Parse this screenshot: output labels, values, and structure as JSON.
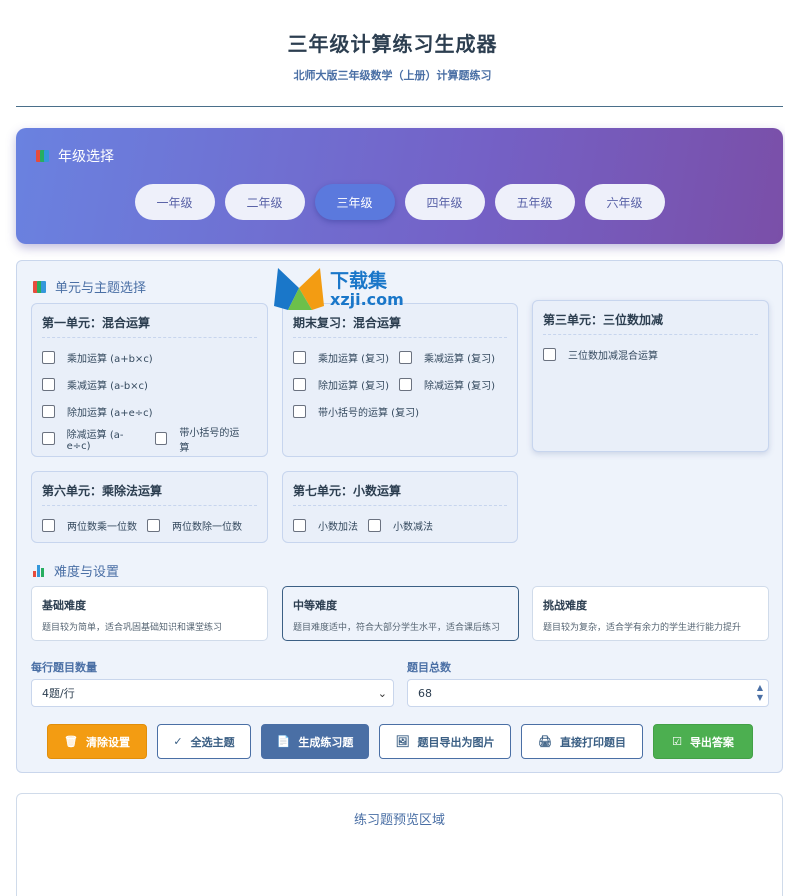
{
  "header": {
    "title": "三年级计算练习生成器",
    "subtitle": "北师大版三年级数学（上册）计算题练习"
  },
  "grade_section": {
    "label": "年级选择",
    "grades": [
      "一年级",
      "二年级",
      "三年级",
      "四年级",
      "五年级",
      "六年级"
    ],
    "active": "三年级"
  },
  "units_section": {
    "label": "单元与主题选择",
    "units": [
      {
        "title": "第一单元：混合运算",
        "options": [
          "乘加运算 (a+b×c)",
          "乘减运算 (a-b×c)",
          "除加运算 (a+e÷c)",
          "除减运算 (a-e÷c)",
          "带小括号的运算"
        ]
      },
      {
        "title": "期末复习：混合运算",
        "options": [
          "乘加运算 (复习)",
          "乘减运算 (复习)",
          "除加运算 (复习)",
          "除减运算 (复习)",
          "带小括号的运算 (复习)"
        ]
      },
      {
        "title": "第三单元：三位数加减",
        "options": [
          "三位数加减混合运算"
        ]
      },
      {
        "title": "第六单元：乘除法运算",
        "options": [
          "两位数乘一位数",
          "两位数除一位数"
        ]
      },
      {
        "title": "第七单元：小数运算",
        "options": [
          "小数加法",
          "小数减法"
        ]
      }
    ]
  },
  "difficulty_section": {
    "label": "难度与设置",
    "levels": [
      {
        "title": "基础难度",
        "desc": "题目较为简单，适合巩固基础知识和课堂练习"
      },
      {
        "title": "中等难度",
        "desc": "题目难度适中，符合大部分学生水平，适合课后练习"
      },
      {
        "title": "挑战难度",
        "desc": "题目较为复杂，适合学有余力的学生进行能力提升"
      }
    ],
    "selected": "中等难度"
  },
  "settings": {
    "per_row_label": "每行题目数量",
    "per_row_value": "4题/行",
    "total_label": "题目总数",
    "total_value": "68"
  },
  "buttons": {
    "clear": "清除设置",
    "select_all": "全选主题",
    "generate": "生成练习题",
    "export_image": "题目导出为图片",
    "print": "直接打印题目",
    "export_answers": "导出答案"
  },
  "preview": {
    "title": "练习题预览区域"
  },
  "watermark": {
    "name": "下载集",
    "url": "xzji.com"
  }
}
